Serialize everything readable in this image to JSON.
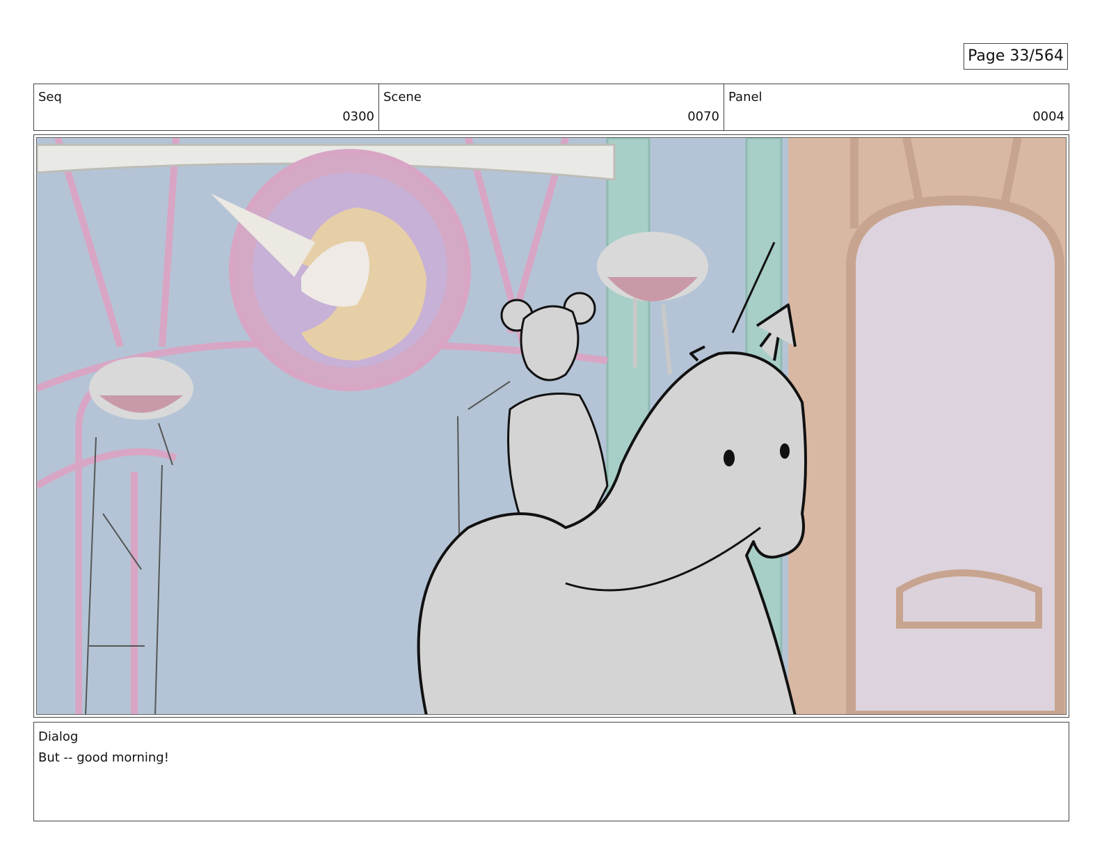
{
  "page": {
    "label": "Page",
    "number": "33/564"
  },
  "header": {
    "seq": {
      "label": "Seq",
      "value": "0300"
    },
    "scene": {
      "label": "Scene",
      "value": "0070"
    },
    "panel": {
      "label": "Panel",
      "value": "0004"
    }
  },
  "dialog": {
    "label": "Dialog",
    "text": "But -- good morning!"
  },
  "colors": {
    "sky": "#b4c4d6",
    "pink_ironwork": "#d8a6c4",
    "teal_ironwork": "#a8cfc7",
    "peach_wall": "#d9b8a3",
    "lavender_window": "#ddd3de",
    "sketch_fill": "#d4d4d4",
    "sketch_line": "#111111"
  }
}
